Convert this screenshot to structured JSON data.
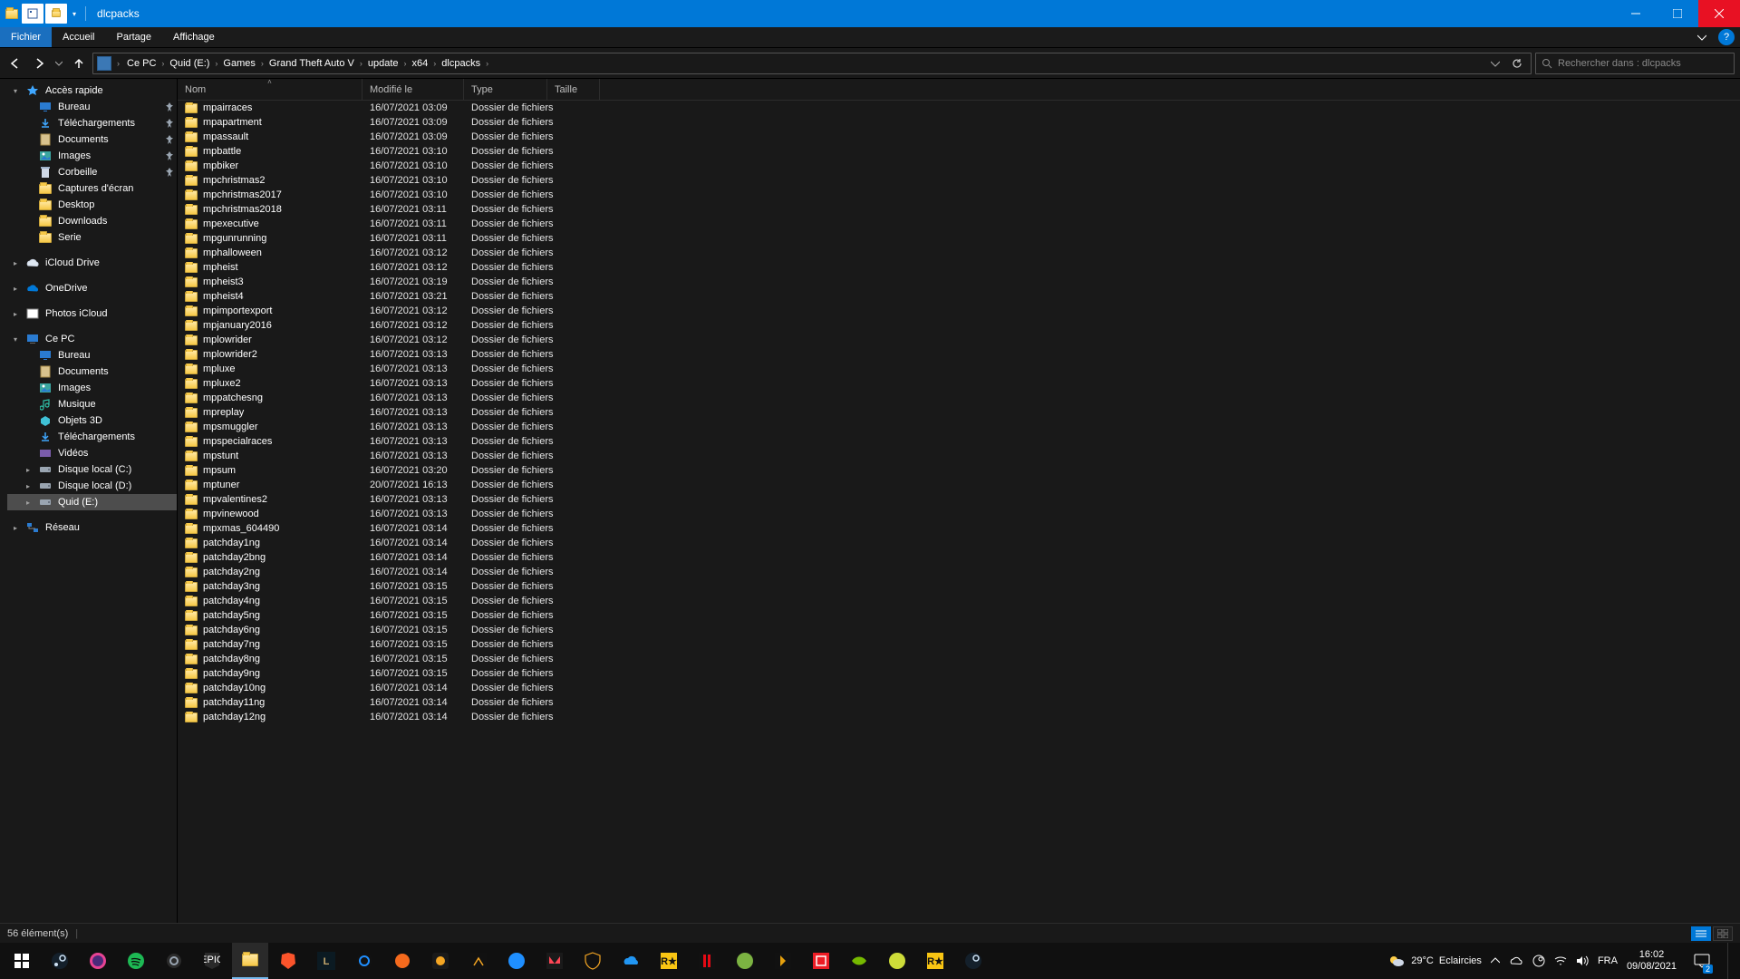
{
  "window": {
    "title": "dlcpacks"
  },
  "menu": {
    "file": "Fichier",
    "home": "Accueil",
    "share": "Partage",
    "view": "Affichage"
  },
  "breadcrumbs": [
    "Ce PC",
    "Quid (E:)",
    "Games",
    "Grand Theft Auto V",
    "update",
    "x64",
    "dlcpacks"
  ],
  "search": {
    "placeholder": "Rechercher dans : dlcpacks"
  },
  "columns": {
    "name": "Nom",
    "modified": "Modifié le",
    "type": "Type",
    "size": "Taille"
  },
  "type_label": "Dossier de fichiers",
  "statusbar": {
    "count": "56 élément(s)"
  },
  "sidebar": {
    "quick": {
      "label": "Accès rapide"
    },
    "desktop": {
      "label": "Bureau"
    },
    "downloads": {
      "label": "Téléchargements"
    },
    "documents": {
      "label": "Documents"
    },
    "images": {
      "label": "Images"
    },
    "recycle": {
      "label": "Corbeille"
    },
    "screenshots": {
      "label": "Captures d'écran"
    },
    "desktop2": {
      "label": "Desktop"
    },
    "downloads2": {
      "label": "Downloads"
    },
    "serie": {
      "label": "Serie"
    },
    "icloud": {
      "label": "iCloud Drive"
    },
    "onedrive": {
      "label": "OneDrive"
    },
    "photos": {
      "label": "Photos iCloud"
    },
    "thispc": {
      "label": "Ce PC"
    },
    "pc_desktop": {
      "label": "Bureau"
    },
    "pc_docs": {
      "label": "Documents"
    },
    "pc_images": {
      "label": "Images"
    },
    "pc_music": {
      "label": "Musique"
    },
    "pc_3d": {
      "label": "Objets 3D"
    },
    "pc_dl": {
      "label": "Téléchargements"
    },
    "pc_videos": {
      "label": "Vidéos"
    },
    "pc_diskc": {
      "label": "Disque local (C:)"
    },
    "pc_diskd": {
      "label": "Disque local (D:)"
    },
    "pc_quide": {
      "label": "Quid (E:)"
    },
    "network": {
      "label": "Réseau"
    }
  },
  "files": [
    {
      "name": "mpairraces",
      "mod": "16/07/2021 03:09"
    },
    {
      "name": "mpapartment",
      "mod": "16/07/2021 03:09"
    },
    {
      "name": "mpassault",
      "mod": "16/07/2021 03:09"
    },
    {
      "name": "mpbattle",
      "mod": "16/07/2021 03:10"
    },
    {
      "name": "mpbiker",
      "mod": "16/07/2021 03:10"
    },
    {
      "name": "mpchristmas2",
      "mod": "16/07/2021 03:10"
    },
    {
      "name": "mpchristmas2017",
      "mod": "16/07/2021 03:10"
    },
    {
      "name": "mpchristmas2018",
      "mod": "16/07/2021 03:11"
    },
    {
      "name": "mpexecutive",
      "mod": "16/07/2021 03:11"
    },
    {
      "name": "mpgunrunning",
      "mod": "16/07/2021 03:11"
    },
    {
      "name": "mphalloween",
      "mod": "16/07/2021 03:12"
    },
    {
      "name": "mpheist",
      "mod": "16/07/2021 03:12"
    },
    {
      "name": "mpheist3",
      "mod": "16/07/2021 03:19"
    },
    {
      "name": "mpheist4",
      "mod": "16/07/2021 03:21"
    },
    {
      "name": "mpimportexport",
      "mod": "16/07/2021 03:12"
    },
    {
      "name": "mpjanuary2016",
      "mod": "16/07/2021 03:12"
    },
    {
      "name": "mplowrider",
      "mod": "16/07/2021 03:12"
    },
    {
      "name": "mplowrider2",
      "mod": "16/07/2021 03:13"
    },
    {
      "name": "mpluxe",
      "mod": "16/07/2021 03:13"
    },
    {
      "name": "mpluxe2",
      "mod": "16/07/2021 03:13"
    },
    {
      "name": "mppatchesng",
      "mod": "16/07/2021 03:13"
    },
    {
      "name": "mpreplay",
      "mod": "16/07/2021 03:13"
    },
    {
      "name": "mpsmuggler",
      "mod": "16/07/2021 03:13"
    },
    {
      "name": "mpspecialraces",
      "mod": "16/07/2021 03:13"
    },
    {
      "name": "mpstunt",
      "mod": "16/07/2021 03:13"
    },
    {
      "name": "mpsum",
      "mod": "16/07/2021 03:20"
    },
    {
      "name": "mptuner",
      "mod": "20/07/2021 16:13"
    },
    {
      "name": "mpvalentines2",
      "mod": "16/07/2021 03:13"
    },
    {
      "name": "mpvinewood",
      "mod": "16/07/2021 03:13"
    },
    {
      "name": "mpxmas_604490",
      "mod": "16/07/2021 03:14"
    },
    {
      "name": "patchday1ng",
      "mod": "16/07/2021 03:14"
    },
    {
      "name": "patchday2bng",
      "mod": "16/07/2021 03:14"
    },
    {
      "name": "patchday2ng",
      "mod": "16/07/2021 03:14"
    },
    {
      "name": "patchday3ng",
      "mod": "16/07/2021 03:15"
    },
    {
      "name": "patchday4ng",
      "mod": "16/07/2021 03:15"
    },
    {
      "name": "patchday5ng",
      "mod": "16/07/2021 03:15"
    },
    {
      "name": "patchday6ng",
      "mod": "16/07/2021 03:15"
    },
    {
      "name": "patchday7ng",
      "mod": "16/07/2021 03:15"
    },
    {
      "name": "patchday8ng",
      "mod": "16/07/2021 03:15"
    },
    {
      "name": "patchday9ng",
      "mod": "16/07/2021 03:15"
    },
    {
      "name": "patchday10ng",
      "mod": "16/07/2021 03:14"
    },
    {
      "name": "patchday11ng",
      "mod": "16/07/2021 03:14"
    },
    {
      "name": "patchday12ng",
      "mod": "16/07/2021 03:14"
    }
  ],
  "tray": {
    "weather_temp": "29°C",
    "weather_text": "Eclaircies",
    "lang": "FRA",
    "time": "16:02",
    "date": "09/08/2021",
    "notif_count": "2"
  }
}
